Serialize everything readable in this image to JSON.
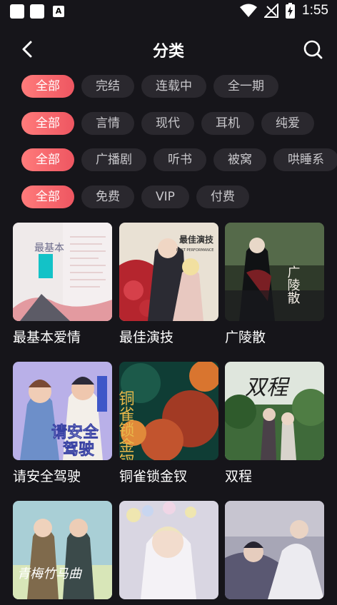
{
  "status_bar": {
    "time": "1:55"
  },
  "header": {
    "title": "分类"
  },
  "filters": [
    [
      "全部",
      "完结",
      "连载中",
      "全一期"
    ],
    [
      "全部",
      "言情",
      "现代",
      "耳机",
      "纯爱"
    ],
    [
      "全部",
      "广播剧",
      "听书",
      "被窝",
      "哄睡系"
    ],
    [
      "全部",
      "免费",
      "VIP",
      "付费"
    ]
  ],
  "items": [
    {
      "title": "最基本爱情"
    },
    {
      "title": "最佳演技"
    },
    {
      "title": "广陵散"
    },
    {
      "title": "请安全驾驶"
    },
    {
      "title": "铜雀锁金钗"
    },
    {
      "title": "双程"
    },
    {
      "title": ""
    },
    {
      "title": ""
    },
    {
      "title": ""
    }
  ],
  "cover_text": {
    "c1": "最基本",
    "c2": "最佳演技",
    "c2_sub": "BEST PERFORMANCE",
    "c3": "广陵散",
    "c4_line1": "请安全",
    "c4_line2": "驾驶",
    "c5": "铜雀锁金钗",
    "c6": "双程",
    "c7": "青梅竹马曲"
  },
  "colors": {
    "accent": "#ee5661",
    "background": "#16151a",
    "chip": "#2a282e"
  }
}
